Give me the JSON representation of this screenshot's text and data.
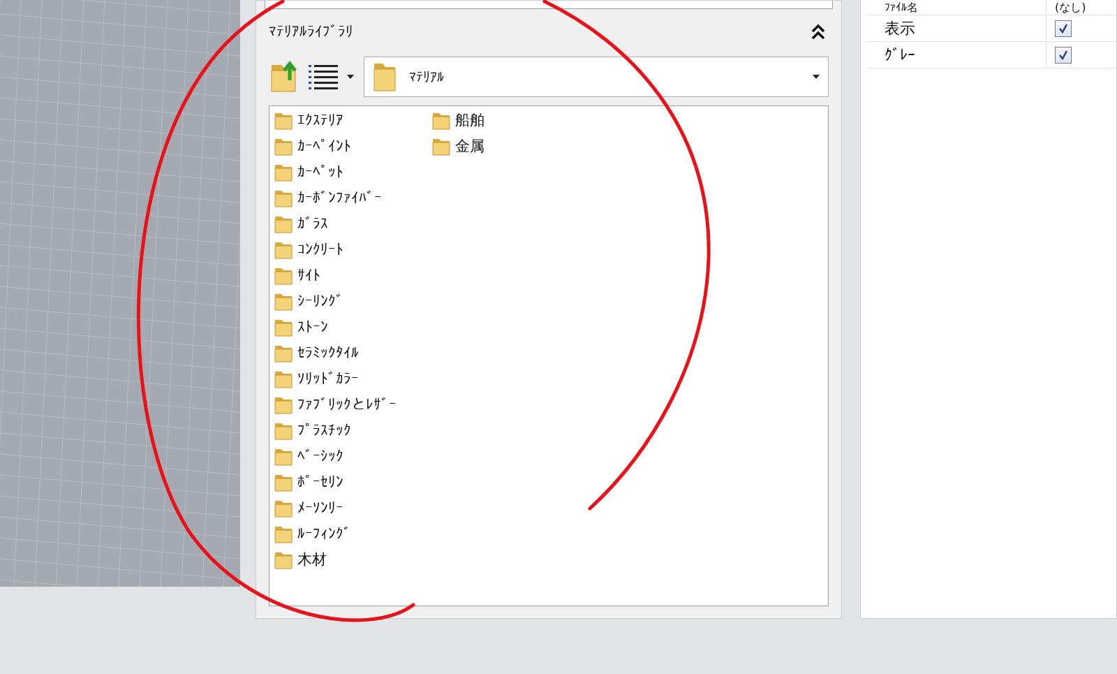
{
  "library_panel": {
    "title": "ﾏﾃﾘｱﾙﾗｲﾌﾞﾗﾘ",
    "folder_dropdown": {
      "value": "ﾏﾃﾘｱﾙ"
    },
    "folders": [
      {
        "name": "ｴｸｽﾃﾘｱ"
      },
      {
        "name": "ｶｰﾍﾟｲﾝﾄ"
      },
      {
        "name": "ｶｰﾍﾟｯﾄ"
      },
      {
        "name": "ｶｰﾎﾞﾝﾌｧｲﾊﾞｰ"
      },
      {
        "name": "ｶﾞﾗｽ"
      },
      {
        "name": "ｺﾝｸﾘｰﾄ"
      },
      {
        "name": "ｻｲﾄ"
      },
      {
        "name": "ｼｰﾘﾝｸﾞ"
      },
      {
        "name": "ｽﾄｰﾝ"
      },
      {
        "name": "ｾﾗﾐｯｸﾀｲﾙ"
      },
      {
        "name": "ｿﾘｯﾄﾞｶﾗｰ"
      },
      {
        "name": "ﾌｧﾌﾞﾘｯｸとﾚｻﾞｰ"
      },
      {
        "name": "ﾌﾟﾗｽﾁｯｸ"
      },
      {
        "name": "ﾍﾞｰｼｯｸ"
      },
      {
        "name": "ﾎﾟｰｾﾘﾝ"
      },
      {
        "name": "ﾒｰｿﾝﾘｰ"
      },
      {
        "name": "ﾙｰﾌｨﾝｸﾞ"
      },
      {
        "name": "木材"
      },
      {
        "name": "船舶"
      },
      {
        "name": "金属"
      }
    ]
  },
  "properties": {
    "rows": [
      {
        "kind": "text",
        "label": "ﾌｧｲﾙ名",
        "value": "(なし)"
      },
      {
        "kind": "checkbox",
        "label": "表示",
        "checked": true
      },
      {
        "kind": "checkbox",
        "label": "ｸﾞﾚｰ",
        "checked": true
      }
    ]
  }
}
